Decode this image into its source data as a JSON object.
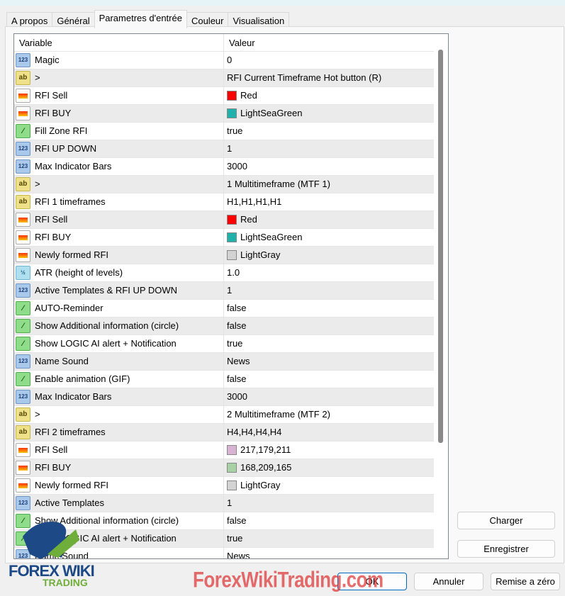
{
  "tabs": [
    {
      "label": "A propos"
    },
    {
      "label": "Général"
    },
    {
      "label": "Parametres d'entrée",
      "active": true
    },
    {
      "label": "Couleur"
    },
    {
      "label": "Visualisation"
    }
  ],
  "table": {
    "headers": {
      "variable": "Variable",
      "value": "Valeur"
    },
    "rows": [
      {
        "type": "int",
        "name": "Magic",
        "value": "0"
      },
      {
        "type": "str",
        "name": ">",
        "value": "RFI Current Timeframe Hot button (R)"
      },
      {
        "type": "color",
        "name": "RFI Sell",
        "value": "Red",
        "color": "#ff0000"
      },
      {
        "type": "color",
        "name": "RFI BUY",
        "value": "LightSeaGreen",
        "color": "#20b2aa"
      },
      {
        "type": "bool",
        "name": "Fill Zone RFI",
        "value": "true"
      },
      {
        "type": "int",
        "name": "RFI UP DOWN",
        "value": "1"
      },
      {
        "type": "int",
        "name": "Max Indicator Bars",
        "value": "3000"
      },
      {
        "type": "str",
        "name": ">",
        "value": "1 Multitimeframe (MTF 1)"
      },
      {
        "type": "str",
        "name": "RFI 1 timeframes",
        "value": "H1,H1,H1,H1"
      },
      {
        "type": "color",
        "name": "RFI Sell",
        "value": "Red",
        "color": "#ff0000"
      },
      {
        "type": "color",
        "name": "RFI BUY",
        "value": "LightSeaGreen",
        "color": "#20b2aa"
      },
      {
        "type": "color",
        "name": "Newly formed RFI",
        "value": "LightGray",
        "color": "#d3d3d3"
      },
      {
        "type": "dbl",
        "name": "ATR (height of levels)",
        "value": "1.0"
      },
      {
        "type": "int",
        "name": "Active Templates & RFI UP DOWN",
        "value": "1"
      },
      {
        "type": "bool",
        "name": "AUTO-Reminder",
        "value": "false"
      },
      {
        "type": "bool",
        "name": "Show Additional information (circle)",
        "value": "false"
      },
      {
        "type": "bool",
        "name": "Show LOGIC AI alert + Notification",
        "value": "true"
      },
      {
        "type": "int",
        "name": "Name Sound",
        "value": "News"
      },
      {
        "type": "bool",
        "name": "Enable animation (GIF)",
        "value": "false"
      },
      {
        "type": "int",
        "name": "Max Indicator Bars",
        "value": "3000"
      },
      {
        "type": "str",
        "name": ">",
        "value": "2 Multitimeframe (MTF 2)"
      },
      {
        "type": "str",
        "name": "RFI 2 timeframes",
        "value": "H4,H4,H4,H4"
      },
      {
        "type": "color",
        "name": "RFI Sell",
        "value": "217,179,211",
        "color": "#d9b3d3"
      },
      {
        "type": "color",
        "name": "RFI BUY",
        "value": "168,209,165",
        "color": "#a8d1a5"
      },
      {
        "type": "color",
        "name": "Newly formed RFI",
        "value": "LightGray",
        "color": "#d3d3d3"
      },
      {
        "type": "int",
        "name": "Active Templates",
        "value": "1"
      },
      {
        "type": "bool",
        "name": "Show Additional information (circle)",
        "value": "false"
      },
      {
        "type": "bool",
        "name": "Show LOGIC AI alert + Notification",
        "value": "true"
      },
      {
        "type": "int",
        "name": "Name Sound",
        "value": "News"
      }
    ]
  },
  "buttons": {
    "load": "Charger",
    "save": "Enregistrer",
    "ok": "OK",
    "cancel": "Annuler",
    "reset": "Remise a zéro"
  },
  "watermark": {
    "logo": "FOREX WIKI",
    "logo_sub": "TRADING",
    "site": "ForexWikiTrading.com"
  }
}
